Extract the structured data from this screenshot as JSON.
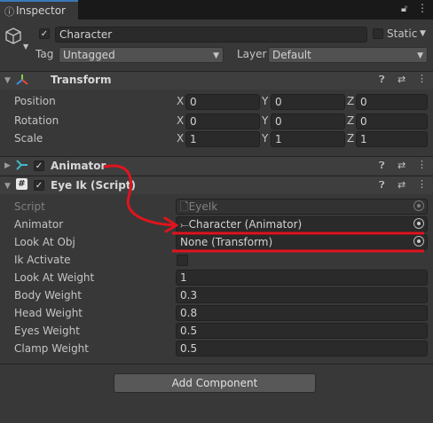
{
  "tab": {
    "label": "Inspector"
  },
  "header": {
    "name": "Character",
    "static_label": "Static",
    "tag_label": "Tag",
    "tag_value": "Untagged",
    "layer_label": "Layer",
    "layer_value": "Default"
  },
  "transform": {
    "title": "Transform",
    "rows": [
      {
        "label": "Position",
        "x": "0",
        "y": "0",
        "z": "0"
      },
      {
        "label": "Rotation",
        "x": "0",
        "y": "0",
        "z": "0"
      },
      {
        "label": "Scale",
        "x": "1",
        "y": "1",
        "z": "1"
      }
    ],
    "axes": [
      "X",
      "Y",
      "Z"
    ]
  },
  "animator": {
    "title": "Animator"
  },
  "eyeik": {
    "title": "Eye Ik (Script)",
    "script_label": "Script",
    "script_value": "EyeIk",
    "animator_label": "Animator",
    "animator_value": "Character (Animator)",
    "lookatobj_label": "Look At Obj",
    "lookatobj_value": "None (Transform)",
    "ikactivate_label": "Ik Activate",
    "lookatweight_label": "Look At Weight",
    "lookatweight_value": "1",
    "bodyweight_label": "Body Weight",
    "bodyweight_value": "0.3",
    "headweight_label": "Head Weight",
    "headweight_value": "0.8",
    "eyesweight_label": "Eyes Weight",
    "eyesweight_value": "0.5",
    "clampweight_label": "Clamp Weight",
    "clampweight_value": "0.5"
  },
  "add_component": {
    "label": "Add Component"
  },
  "annotation": {
    "color": "#e0141e"
  }
}
